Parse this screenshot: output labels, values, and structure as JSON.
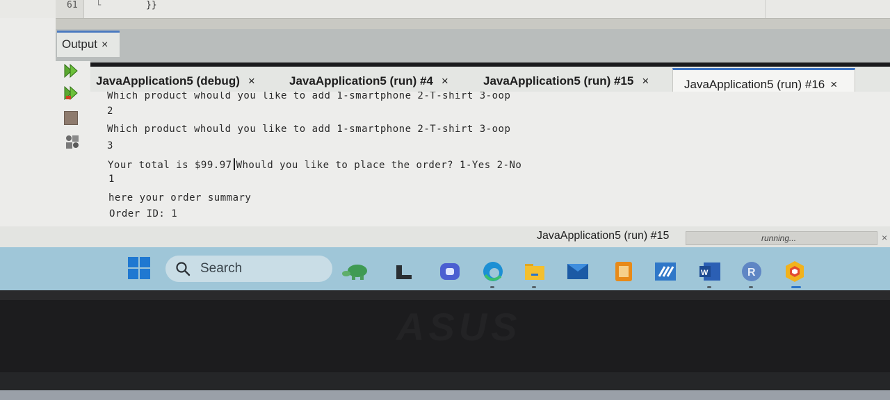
{
  "editor": {
    "line_number": "61",
    "code": "}}"
  },
  "output_panel": {
    "title": "Output",
    "close": "×"
  },
  "tabs": [
    {
      "label": "JavaApplication5 (debug)",
      "close": "×"
    },
    {
      "label": "JavaApplication5 (run) #4",
      "close": "×"
    },
    {
      "label": "JavaApplication5 (run) #15",
      "close": "×"
    },
    {
      "label": "JavaApplication5 (run) #16",
      "close": "×"
    }
  ],
  "console": {
    "lines": [
      "Which product whould you like to add 1-smartphone 2-T-shirt 3-oop",
      "2",
      "Which product whould you like to add 1-smartphone 2-T-shirt 3-oop",
      "3",
      "Your total is $99.97",
      "Whould you like to place the order? 1-Yes 2-No",
      "1",
      "here your order summary",
      "Order ID: 1"
    ]
  },
  "status": {
    "task": "JavaApplication5 (run) #15",
    "progress_text": "running...",
    "close": "×"
  },
  "taskbar": {
    "search_label": "Search",
    "apps": [
      "turtle-app-icon",
      "file-manager-icon",
      "chat-app-icon",
      "edge-icon",
      "folder-icon",
      "mail-icon",
      "office-app-icon",
      "ide-app-icon",
      "word-icon",
      "r-app-icon",
      "netbeans-icon"
    ],
    "accent": "#1f78d1"
  },
  "bezel": {
    "brand": "ASUS"
  }
}
